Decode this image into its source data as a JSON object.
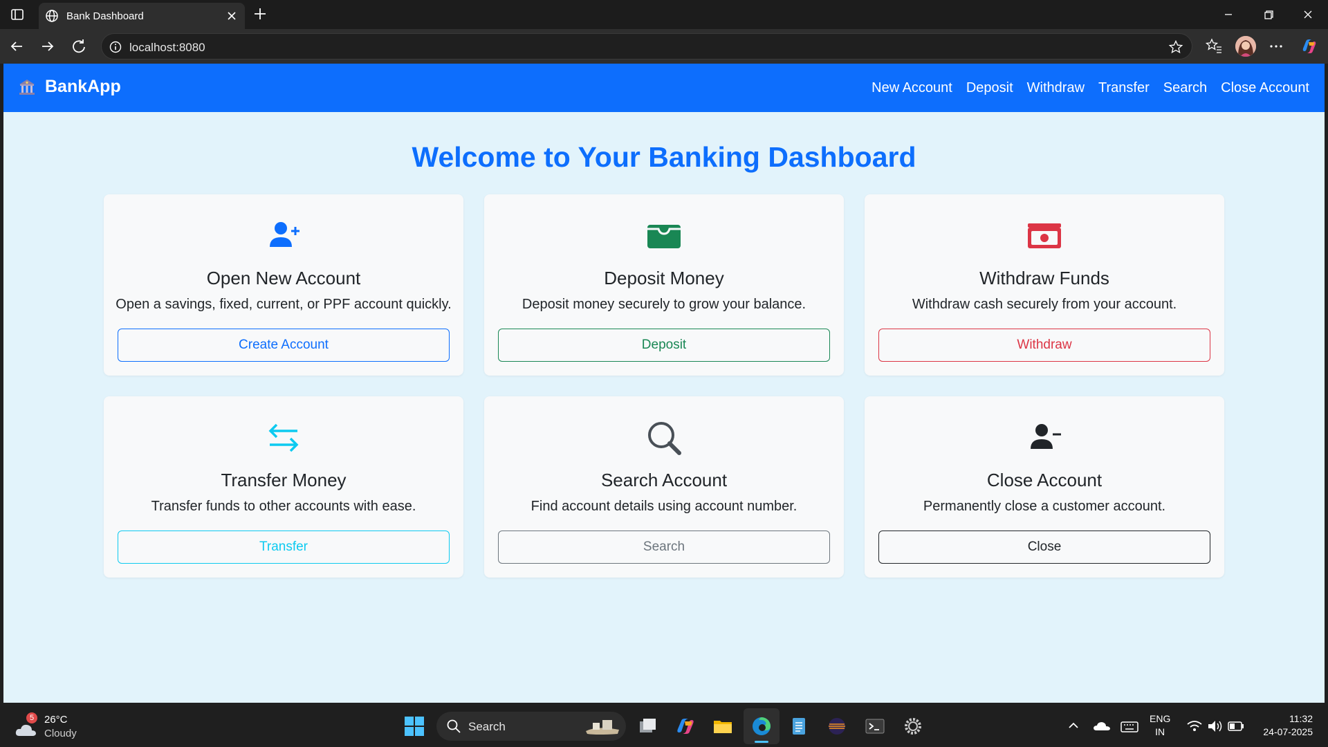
{
  "browser": {
    "tab_title": "Bank Dashboard",
    "url": "localhost:8080"
  },
  "navbar": {
    "brand": "BankApp",
    "links": [
      "New Account",
      "Deposit",
      "Withdraw",
      "Transfer",
      "Search",
      "Close Account"
    ]
  },
  "welcome": "Welcome to Your Banking Dashboard",
  "cards": [
    {
      "icon": "user-plus-icon",
      "title": "Open New Account",
      "desc": "Open a savings, fixed, current, or PPF account quickly.",
      "button": "Create Account",
      "color": "#0d6efd"
    },
    {
      "icon": "wallet-icon",
      "title": "Deposit Money",
      "desc": "Deposit money securely to grow your balance.",
      "button": "Deposit",
      "color": "#198754"
    },
    {
      "icon": "cash-icon",
      "title": "Withdraw Funds",
      "desc": "Withdraw cash securely from your account.",
      "button": "Withdraw",
      "color": "#dc3545"
    },
    {
      "icon": "transfer-arrows-icon",
      "title": "Transfer Money",
      "desc": "Transfer funds to other accounts with ease.",
      "button": "Transfer",
      "color": "#0dcaf0"
    },
    {
      "icon": "search-icon",
      "title": "Search Account",
      "desc": "Find account details using account number.",
      "button": "Search",
      "color": "#6c757d"
    },
    {
      "icon": "user-minus-icon",
      "title": "Close Account",
      "desc": "Permanently close a customer account.",
      "button": "Close",
      "color": "#212529"
    }
  ],
  "taskbar": {
    "weather_badge": "5",
    "temperature": "26°C",
    "condition": "Cloudy",
    "search": "Search",
    "lang_line1": "ENG",
    "lang_line2": "IN",
    "time": "11:32",
    "date": "24-07-2025"
  }
}
